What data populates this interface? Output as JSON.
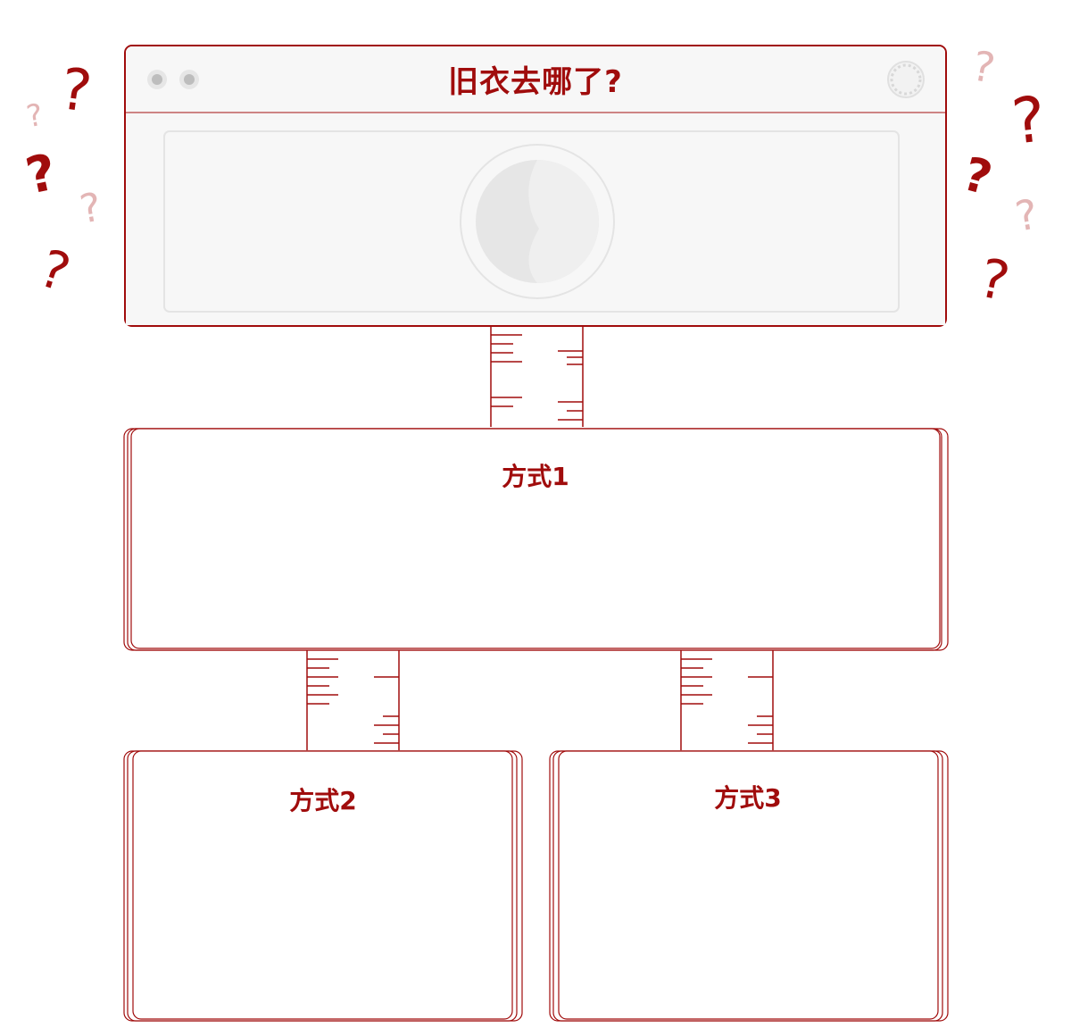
{
  "colors": {
    "accent": "#a00c0c",
    "panel": "#f7f7f7",
    "washer_gray": "#e6e6e6"
  },
  "header": {
    "title": "旧衣去哪了?",
    "icons": [
      "window-dot-icon",
      "window-dot-icon",
      "dashed-circle-icon"
    ]
  },
  "washer_icon": "washing-machine-drum-icon",
  "boxes": [
    {
      "label": "方式1"
    },
    {
      "label": "方式2"
    },
    {
      "label": "方式3"
    }
  ],
  "decorations": {
    "question_mark": "?"
  }
}
